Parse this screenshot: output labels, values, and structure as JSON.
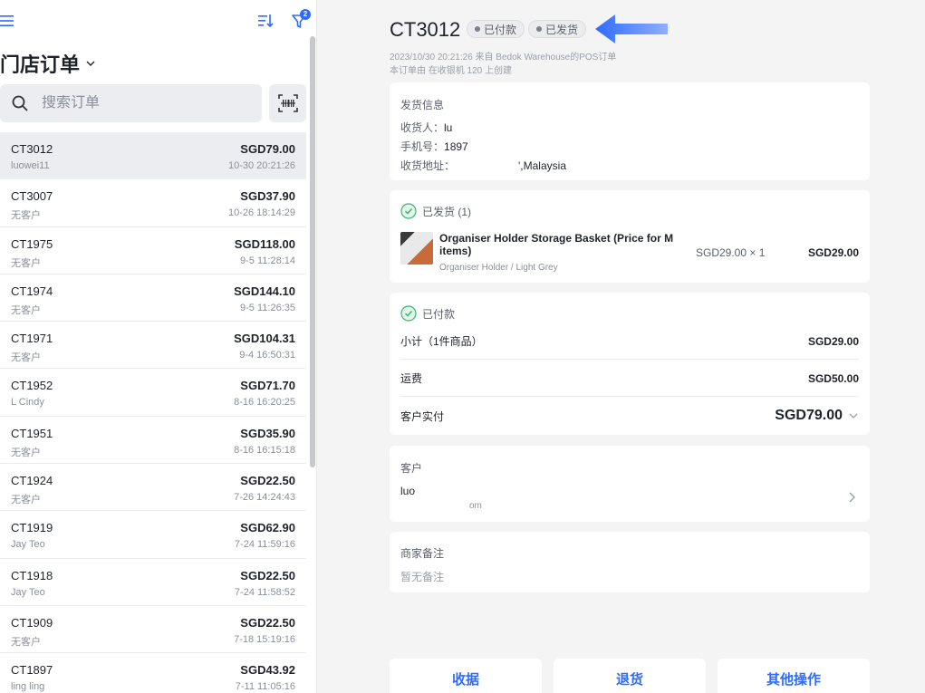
{
  "left": {
    "title": "门店订单",
    "filter_count": "2",
    "search_placeholder": "搜索订单",
    "orders": [
      {
        "id": "CT3012",
        "customer": "luowei11",
        "amount": "SGD79.00",
        "time": "10-30 20:21:26",
        "selected": true
      },
      {
        "id": "CT3007",
        "customer": "无客户",
        "amount": "SGD37.90",
        "time": "10-26 18:14:29"
      },
      {
        "id": "CT1975",
        "customer": "无客户",
        "amount": "SGD118.00",
        "time": "9-5 11:28:14"
      },
      {
        "id": "CT1974",
        "customer": "无客户",
        "amount": "SGD144.10",
        "time": "9-5 11:26:35"
      },
      {
        "id": "CT1971",
        "customer": "无客户",
        "amount": "SGD104.31",
        "time": "9-4 16:50:31"
      },
      {
        "id": "CT1952",
        "customer": "L Cindy",
        "amount": "SGD71.70",
        "time": "8-16 16:20:25"
      },
      {
        "id": "CT1951",
        "customer": "无客户",
        "amount": "SGD35.90",
        "time": "8-16 16:15:18"
      },
      {
        "id": "CT1924",
        "customer": "无客户",
        "amount": "SGD22.50",
        "time": "7-26 14:24:43"
      },
      {
        "id": "CT1919",
        "customer": "Jay Teo",
        "amount": "SGD62.90",
        "time": "7-24 11:59:16"
      },
      {
        "id": "CT1918",
        "customer": "Jay Teo",
        "amount": "SGD22.50",
        "time": "7-24 11:58:52"
      },
      {
        "id": "CT1909",
        "customer": "无客户",
        "amount": "SGD22.50",
        "time": "7-18 15:19:16"
      },
      {
        "id": "CT1897",
        "customer": "ling ling",
        "amount": "SGD43.92",
        "time": "7-11 11:05:16"
      }
    ]
  },
  "detail": {
    "order_id": "CT3012",
    "badge_paid": "已付款",
    "badge_shipped": "已发货",
    "meta_line1": "2023/10/30 20:21:26 来自 Bedok Warehouse的POS订单",
    "meta_line2": "本订单由      在收银机  120  上创建",
    "shipping": {
      "title": "发货信息",
      "recipient_label": "收货人：",
      "recipient": "lu",
      "phone_label": "手机号：",
      "phone": "1897",
      "address_label": "收货地址：",
      "address": "',Malaysia"
    },
    "fulfillment": {
      "title": "已发货 (1)",
      "product_name": "Organiser Holder Storage Basket (Price for M items)",
      "product_variant": "Organiser Holder  / Light Grey",
      "unit_qty": "SGD29.00 × 1",
      "line_total": "SGD29.00"
    },
    "payment": {
      "title": "已付款",
      "subtotal_label": "小计（1件商品）",
      "subtotal": "SGD29.00",
      "shipping_label": "运费",
      "shipping": "SGD50.00",
      "paid_label": "客户实付",
      "paid": "SGD79.00"
    },
    "customer": {
      "title": "客户",
      "name": "luo",
      "email": "om"
    },
    "note": {
      "title": "商家备注",
      "empty": "暂无备注"
    },
    "actions": {
      "receipt": "收据",
      "refund": "退货",
      "more": "其他操作"
    }
  },
  "colors": {
    "accent": "#2f6bff",
    "success": "#3cb371"
  }
}
